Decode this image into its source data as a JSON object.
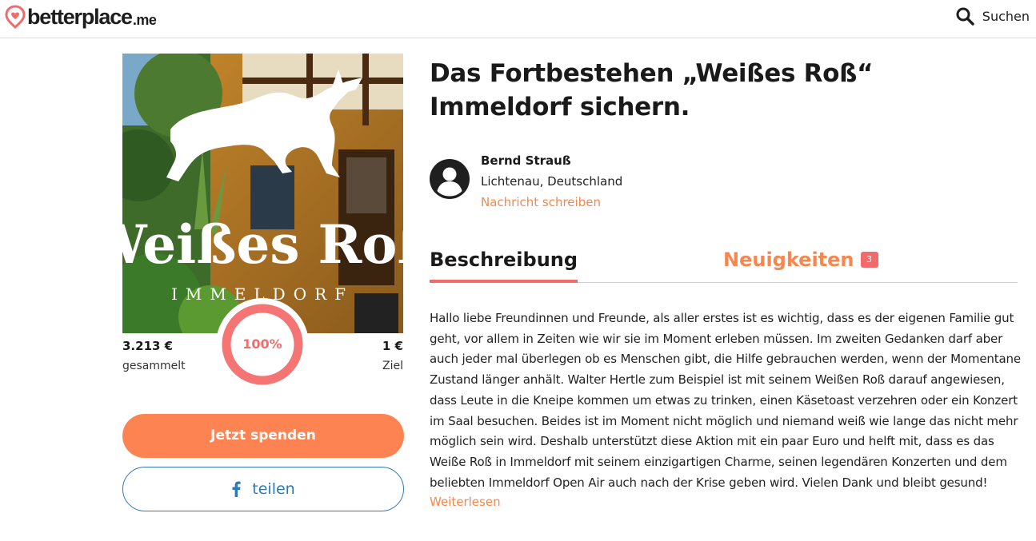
{
  "header": {
    "logo_text": "betterplace",
    "logo_tld": ".me",
    "search_label": "Suchen",
    "icons": [
      "location-pin-icon",
      "search-icon"
    ]
  },
  "hero": {
    "banner_text": "Weißes Roß",
    "banner_subtext": "IMMELDORF"
  },
  "funding": {
    "raised_value": "3.213 €",
    "raised_label": "gesammelt",
    "progress_text": "100%",
    "progress_fraction": 1.0,
    "goal_value": "1 €",
    "goal_label": "Ziel"
  },
  "actions": {
    "donate_label": "Jetzt spenden",
    "share_label": "teilen",
    "share_icon": "facebook-icon"
  },
  "project": {
    "title": "Das Fortbestehen „Weißes Roß“ Immeldorf sichern."
  },
  "author": {
    "name": "Bernd Strauß",
    "location": "Lichtenau, Deutschland",
    "message_link": "Nachricht schreiben",
    "avatar_icon": "user-avatar-icon"
  },
  "tabs": {
    "description": "Beschreibung",
    "news": "Neuigkeiten",
    "news_count": "3"
  },
  "description": {
    "text": "Hallo liebe Freundinnen und Freunde, als aller erstes ist es wichtig, dass es der eigenen Familie gut geht, vor allem in Zeiten wie wir sie im Moment erleben müssen. Im zweiten Gedanken darf aber auch jeder mal überlegen ob es Menschen gibt, die Hilfe gebrauchen werden, wenn der Momentane Zustand länger anhält. Walter Hertle zum Beispiel ist mit seinem Weißen Roß darauf angewiesen, dass Leute in die Kneipe kommen um etwas zu trinken, einen Käsetoast verzehren oder ein Konzert im Saal besuchen. Beides ist im Moment nicht möglich und niemand weiß wie lange das nicht mehr möglich sein wird. Deshalb unterstützt diese Aktion mit ein paar Euro und helft mit, dass es das Weiße Roß in Immeldorf mit seinem einzigartigen Charme, seinen legendären Konzerten und dem beliebten Immeldorf Open Air auch nach der Krise geben wird. Vielen Dank und bleibt gesund!",
    "read_more": "Weiterlesen"
  },
  "colors": {
    "accent_orange": "#fd8452",
    "link_orange": "#f5874f",
    "coral": "#f26b6b",
    "facebook_blue": "#2f7ab5"
  }
}
